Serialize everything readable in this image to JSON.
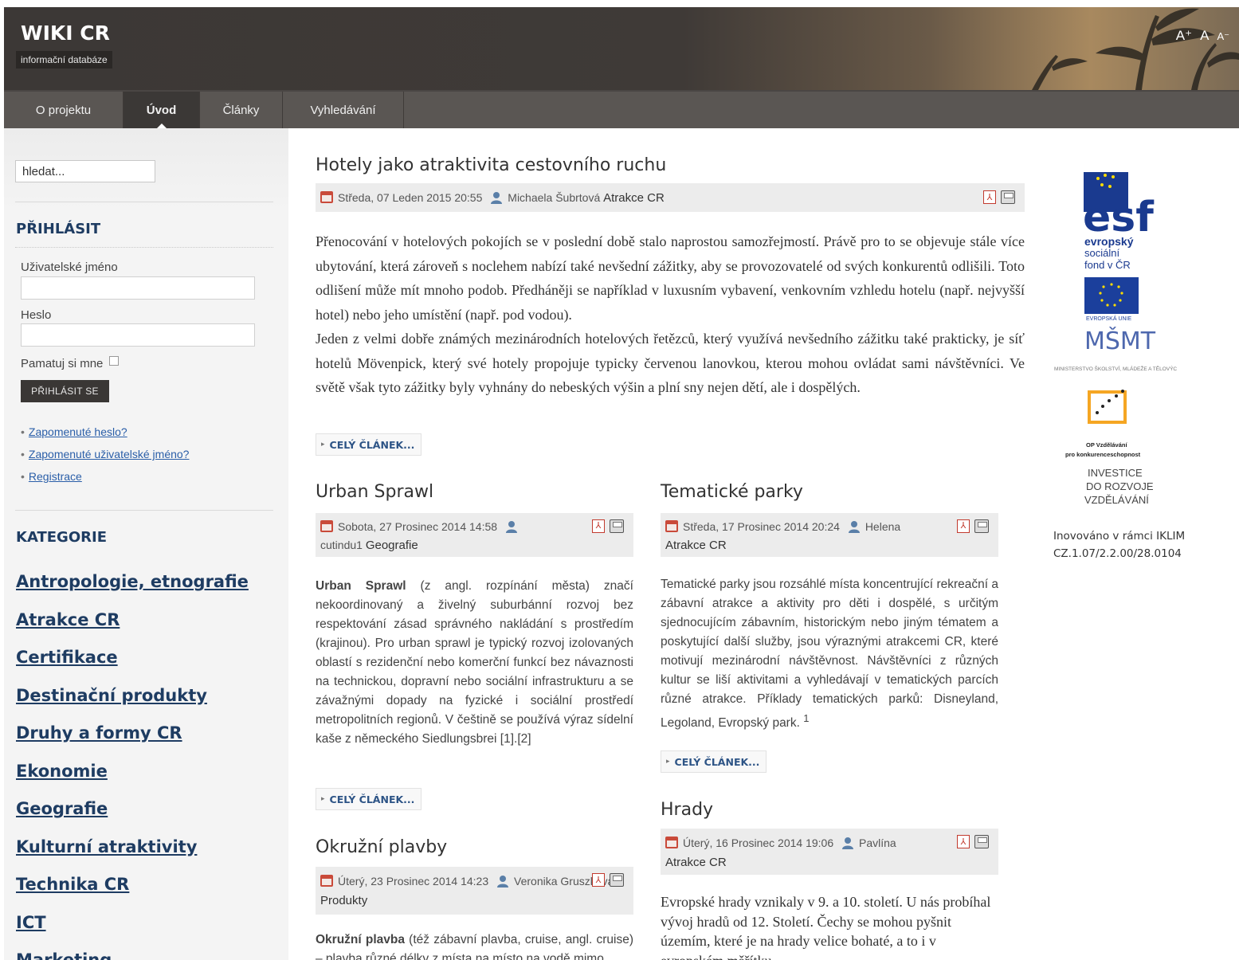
{
  "header": {
    "title": "WIKI CR",
    "subtitle": "informační databáze",
    "font_ctrl": [
      "A⁺",
      "A",
      "A⁻"
    ]
  },
  "nav": {
    "items": [
      "O projektu",
      "Úvod",
      "Články",
      "Vyhledávání"
    ],
    "active": "Úvod"
  },
  "sidebar": {
    "search_value": "hledat...",
    "login": {
      "title": "PŘIHLÁSIT",
      "username_label": "Uživatelské jméno",
      "password_label": "Heslo",
      "remember_label": "Pamatuj si mne",
      "button": "PŘIHLÁSIT SE"
    },
    "links": [
      "Zapomenuté heslo?",
      "Zapomenuté uživatelské jméno?",
      "Registrace"
    ],
    "categories_title": "KATEGORIE",
    "categories": [
      "Antropologie, etnografie",
      "Atrakce CR",
      "Certifikace",
      "Destinační produkty",
      "Druhy a formy CR",
      "Ekonomie",
      "Geografie",
      "Kulturní atraktivity",
      "Technika CR",
      "ICT",
      "Marketing"
    ]
  },
  "articles": {
    "main": {
      "title": "Hotely jako atraktivita cestovního ruchu",
      "date": "Středa, 07 Leden 2015 20:55",
      "author": "Michaela Šubrtová",
      "category": "Atrakce CR",
      "body": "Přenocování v hotelových pokojích se v poslední době stalo naprostou samozřejmostí. Právě pro to se objevuje stále více ubytování, která zároveň s noclehem nabízí také nevšední zážitky, aby se provozovatelé od svých konkurentů odlišili. Toto odlišení může mít mnoho podob. Předháněji se například v luxusním vybavení, venkovním vzhledu hotelu (např. nejvyšší hotel) nebo jeho umístění (např. pod vodou).",
      "body2": "Jeden z velmi dobře známých mezinárodních hotelových řetězců, který využívá nevšedního zážitku také prakticky, je síť hotelů Mövenpick, který své hotely propojuje typicky červenou lanovkou, kterou mohou ovládat sami návštěvníci. Ve světě však tyto zážitky byly vyhnány do nebeských výšin a plní sny nejen dětí, ale i dospělých.",
      "readmore": "CELÝ ČLÁNEK..."
    },
    "urban": {
      "title": "Urban Sprawl",
      "date": "Sobota, 27 Prosinec 2014 14:58",
      "author": "cutindu1",
      "category": "Geografie",
      "body_bold": "Urban Sprawl",
      "body": " (z angl. rozpínání města) značí nekoordinovaný a živelný suburbánní rozvoj bez respektování zásad správného nakládání s prostředím (krajinou). Pro urban sprawl je typický rozvoj izolovaných oblastí s rezidenční nebo komerční funkcí bez návaznosti na technickou, dopravní nebo sociální infrastrukturu a se závažnými dopady na fyzické i sociální prostředí metropolitních regionů. V češtině se používá výraz sídelní kaše z německého Siedlungsbrei [1].[2]",
      "readmore": "CELÝ ČLÁNEK..."
    },
    "parky": {
      "title": "Tematické parky",
      "date": "Středa, 17 Prosinec 2014 20:24",
      "author": "Helena",
      "category": "Atrakce CR",
      "body": "Tematické parky jsou rozsáhlé místa koncentrující rekreační a zábavní atrakce a aktivity pro děti i dospělé, s určitým sjednocujícím zábavním, historickým nebo jiným tématem a poskytující další služby, jsou výraznými atrakcemi CR, které motivují mezinárodní návštěvnost. Návštěvníci z různých kultur se liší aktivitami a vyhledávají v tematických parcích různé atrakce. Příklady tematických parků: Disneyland, Legoland, Evropský park.",
      "footnote": "1",
      "readmore": "CELÝ ČLÁNEK..."
    },
    "okruzni": {
      "title": "Okružní plavby",
      "date": "Úterý, 23 Prosinec 2014 14:23",
      "author": "Veronika Gruszková",
      "category": "Produkty",
      "body_bold": "Okružní plavba",
      "body": " (též zábavní plavba, cruise, angl. cruise) – plavba různé délky z místa na místo na vodě mimo"
    },
    "hrady": {
      "title": "Hrady",
      "date": "Úterý, 16 Prosinec 2014 19:06",
      "author": "Pavlína",
      "category": "Atrakce CR",
      "body": "Evropské hrady vznikaly v 9. a 10. století. U nás probíhal vývoj hradů od 12. Století. Čechy se mohou pyšnit územím, které je na hrady velice bohaté, a to i v evropském měřítku."
    }
  },
  "logos": {
    "esf_big": "esf",
    "esf_line1": "evropský",
    "esf_line2": "sociální",
    "esf_line3": "fond v ČR",
    "eu_label": "EVROPSKÁ UNIE",
    "msmt_mark": "MŠMT",
    "msmt_label": "MINISTERSTVO ŠKOLSTVÍ, MLÁDEŽE A TĚLOVÝCHOVY",
    "op_line1": "OP Vzdělávání",
    "op_line2": "pro konkurenceschopnost",
    "invest1": "INVESTICE",
    "invest2": "DO ROZVOJE",
    "invest3": "VZDĚLÁVÁNÍ",
    "inov1": "Inovováno v rámci IKLIM",
    "inov2": "CZ.1.07/2.2.00/28.0104"
  }
}
